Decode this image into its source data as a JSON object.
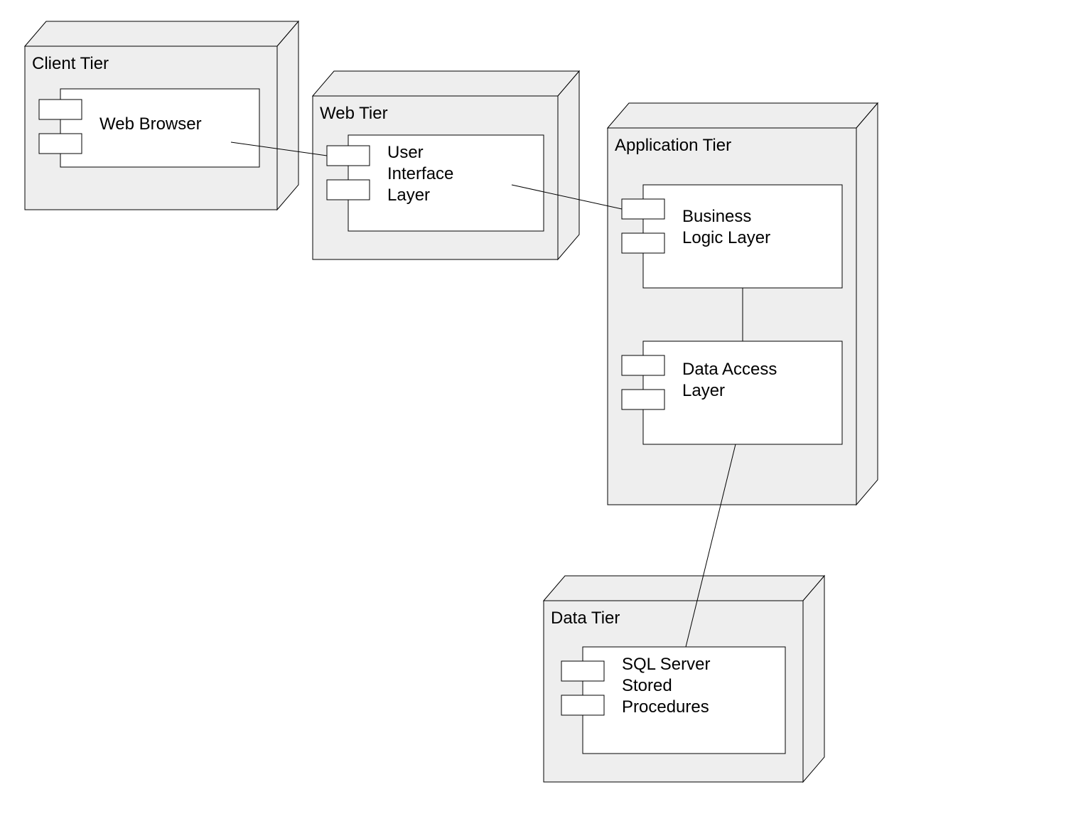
{
  "nodes": {
    "client": {
      "title": "Client Tier"
    },
    "web": {
      "title": "Web Tier"
    },
    "application": {
      "title": "Application Tier"
    },
    "data": {
      "title": "Data Tier"
    }
  },
  "components": {
    "client_c0": {
      "lines": [
        "Web Browser"
      ]
    },
    "web_c0": {
      "lines": [
        "User",
        "Interface",
        "Layer"
      ]
    },
    "application_c0": {
      "lines": [
        "Business",
        "Logic Layer"
      ]
    },
    "application_c1": {
      "lines": [
        "Data Access",
        "Layer"
      ]
    },
    "data_c0": {
      "lines": [
        "SQL Server",
        "Stored",
        "Procedures"
      ]
    }
  },
  "colors": {
    "node_fill": "#eeeeee",
    "node_stroke": "#000000",
    "component_fill": "#ffffff"
  }
}
